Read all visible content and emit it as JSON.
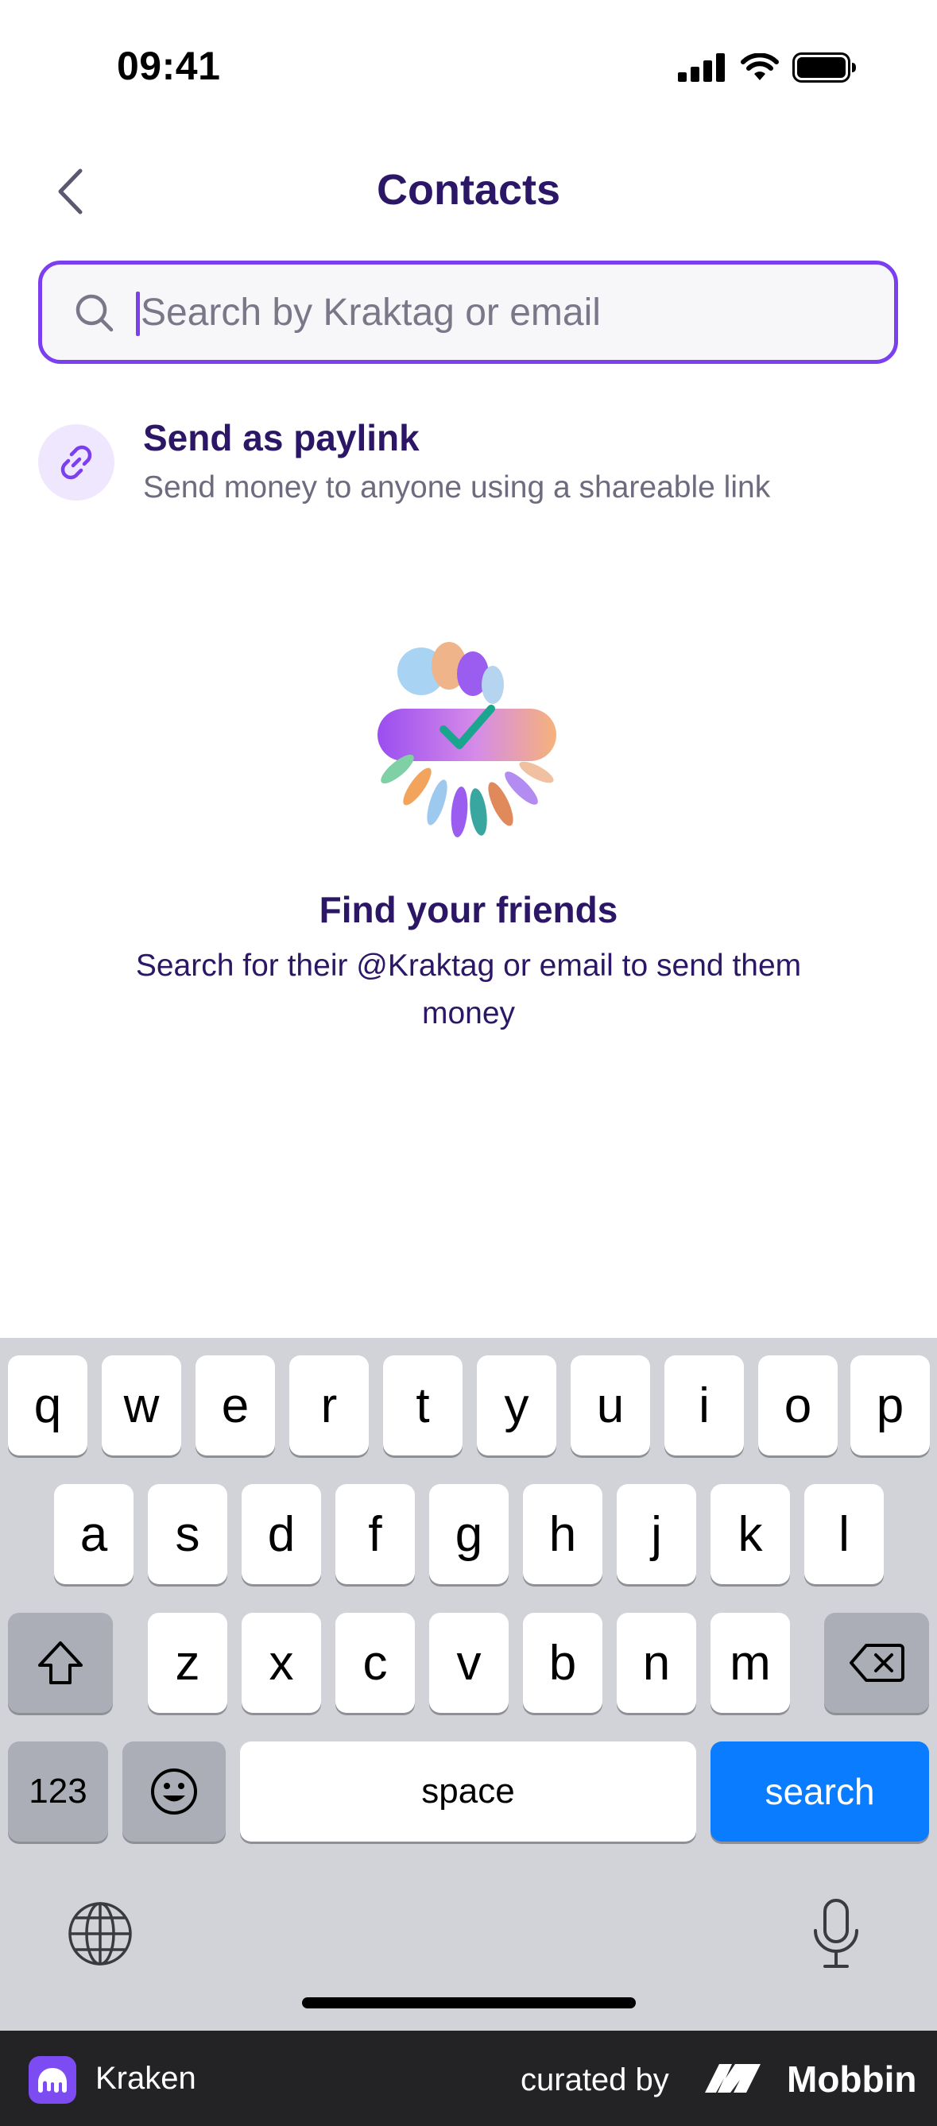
{
  "status_bar": {
    "time": "09:41"
  },
  "header": {
    "title": "Contacts"
  },
  "search": {
    "placeholder": "Search by Kraktag or email",
    "value": ""
  },
  "paylink": {
    "title": "Send as paylink",
    "subtitle": "Send money to anyone using a shareable link"
  },
  "empty_state": {
    "title": "Find your friends",
    "description": "Search for their @Kraktag or email to send them money"
  },
  "keyboard": {
    "row1": [
      "q",
      "w",
      "e",
      "r",
      "t",
      "y",
      "u",
      "i",
      "o",
      "p"
    ],
    "row2": [
      "a",
      "s",
      "d",
      "f",
      "g",
      "h",
      "j",
      "k",
      "l"
    ],
    "row3": [
      "z",
      "x",
      "c",
      "v",
      "b",
      "n",
      "m"
    ],
    "numbers_label": "123",
    "space_label": "space",
    "action_label": "search"
  },
  "footer": {
    "app_name": "Kraken",
    "curated_by": "curated by",
    "brand": "Mobbin"
  },
  "colors": {
    "accent": "#7b3ff0",
    "title": "#2c1766",
    "search_key": "#0a7cff"
  }
}
